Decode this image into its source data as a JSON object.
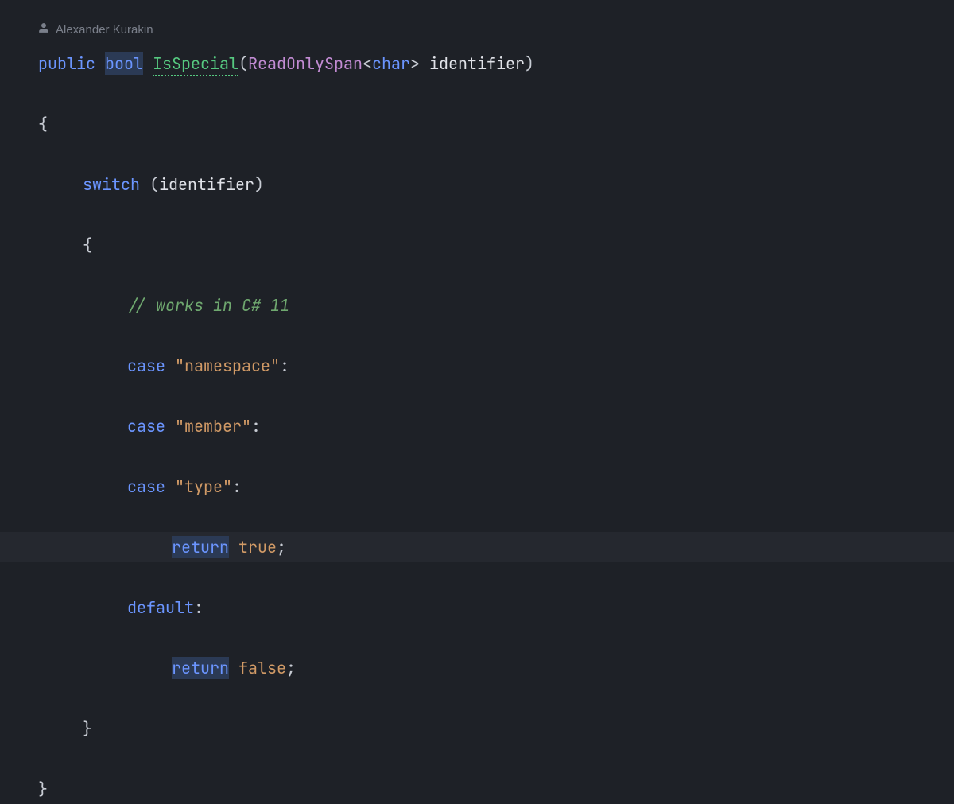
{
  "author": "Alexander Kurakin",
  "code": {
    "kw_public": "public",
    "kw_bool": "bool",
    "method": "IsSpecial",
    "type_span": "ReadOnlySpan",
    "typearg_char": "char",
    "param_identifier": "identifier",
    "kw_switch": "switch",
    "comment": "// works in C# 11",
    "kw_case": "case",
    "str_namespace": "\"namespace\"",
    "str_member": "\"member\"",
    "str_type": "\"type\"",
    "kw_return": "return",
    "lit_true": "true",
    "kw_default": "default",
    "lit_false": "false",
    "lparen": "(",
    "rparen": ")",
    "lbrace": "{",
    "rbrace": "}",
    "lt": "<",
    "gt": ">",
    "colon": ":",
    "semi": ";",
    "space": " "
  }
}
